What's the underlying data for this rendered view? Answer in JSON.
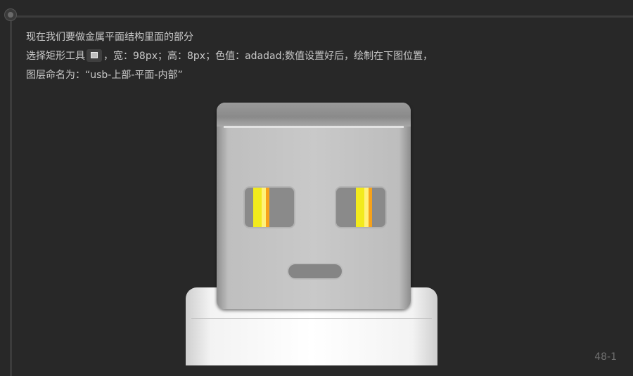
{
  "content": {
    "line1": "现在我们要做金属平面结构里面的部分",
    "line2_prefix": "选择矩形工具",
    "line2_suffix": "，宽：98px；高：8px；色值：adadad;数值设置好后，绘制在下图位置，",
    "line3": "图层命名为：“usb-上部-平面-内部”"
  },
  "page_number": "48-1",
  "icons": {
    "timeline_node": "timeline-node-icon",
    "rectangle_tool": "rectangle-tool-icon"
  },
  "colors": {
    "background": "#282828",
    "text": "#c9c9c9",
    "fill_color_value": "#adadad"
  }
}
